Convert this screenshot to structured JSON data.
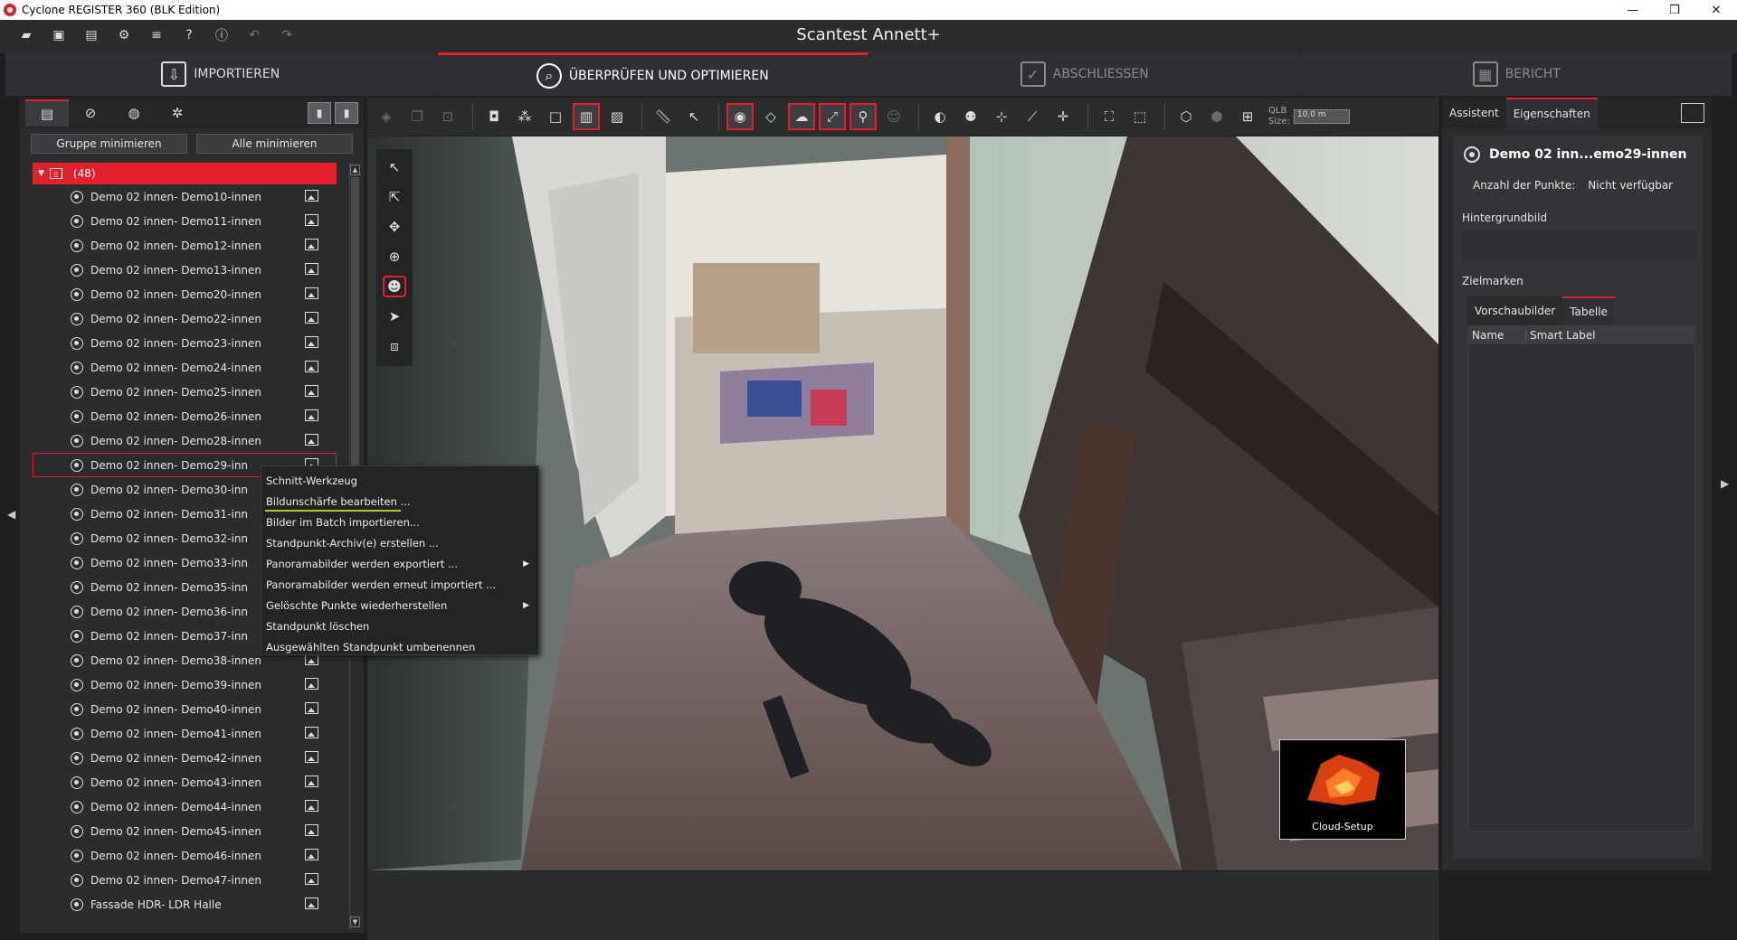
{
  "window": {
    "title": "Cyclone REGISTER 360 (BLK Edition)",
    "controls": [
      "—",
      "❐",
      "✕"
    ]
  },
  "header": {
    "project_title": "Scantest Annett+"
  },
  "steps": [
    {
      "label": "IMPORTIEREN",
      "icon": "import-icon",
      "state": "normal"
    },
    {
      "label": "ÜBERPRÜFEN UND OPTIMIEREN",
      "icon": "review-icon",
      "state": "active"
    },
    {
      "label": "ABSCHLIESSEN",
      "icon": "check-icon",
      "state": "dim"
    },
    {
      "label": "BERICHT",
      "icon": "report-icon",
      "state": "dim"
    }
  ],
  "left_panel": {
    "collapse_group_label": "Gruppe minimieren",
    "collapse_all_label": "Alle minimieren",
    "group_label": "(48)",
    "setups": [
      "Demo 02 innen- Demo10-innen",
      "Demo 02 innen- Demo11-innen",
      "Demo 02 innen- Demo12-innen",
      "Demo 02 innen- Demo13-innen",
      "Demo 02 innen- Demo20-innen",
      "Demo 02 innen- Demo22-innen",
      "Demo 02 innen- Demo23-innen",
      "Demo 02 innen- Demo24-innen",
      "Demo 02 innen- Demo25-innen",
      "Demo 02 innen- Demo26-innen",
      "Demo 02 innen- Demo28-innen",
      "Demo 02 innen- Demo29-inn",
      "Demo 02 innen- Demo30-inn",
      "Demo 02 innen- Demo31-inn",
      "Demo 02 innen- Demo32-inn",
      "Demo 02 innen- Demo33-inn",
      "Demo 02 innen- Demo35-inn",
      "Demo 02 innen- Demo36-inn",
      "Demo 02 innen- Demo37-inn",
      "Demo 02 innen- Demo38-innen",
      "Demo 02 innen- Demo39-innen",
      "Demo 02 innen- Demo40-innen",
      "Demo 02 innen- Demo41-innen",
      "Demo 02 innen- Demo42-innen",
      "Demo 02 innen- Demo43-innen",
      "Demo 02 innen- Demo44-innen",
      "Demo 02 innen- Demo45-innen",
      "Demo 02 innen- Demo46-innen",
      "Demo 02 innen- Demo47-innen",
      "Fassade HDR- LDR Halle"
    ],
    "selected_index": 11
  },
  "context_menu": {
    "items": [
      {
        "label": "Schnitt-Werkzeug",
        "submenu": false
      },
      {
        "label": "Bildunschärfe bearbeiten ...",
        "submenu": false,
        "highlight": true
      },
      {
        "label": "Bilder im Batch importieren...",
        "submenu": false
      },
      {
        "label": "Standpunkt-Archiv(e) erstellen ...",
        "submenu": false
      },
      {
        "label": "Panoramabilder werden exportiert ...",
        "submenu": true
      },
      {
        "label": "Panoramabilder werden erneut importiert ...",
        "submenu": false
      },
      {
        "label": "Gelöschte Punkte wiederherstellen",
        "submenu": true
      },
      {
        "label": "Standpunkt löschen",
        "submenu": false
      },
      {
        "label": "Ausgewählten Standpunkt umbenennen",
        "submenu": false
      }
    ]
  },
  "toolbar": {
    "qlb_label": "QLB",
    "size_label": "Size:",
    "size_value": "10,0 m"
  },
  "viewport": {
    "cloud_setup_label": "Cloud-Setup"
  },
  "right_panel": {
    "tab_assistant": "Assistent",
    "tab_properties": "Eigenschaften",
    "setup_name": "Demo 02 inn...emo29-innen",
    "points_label": "Anzahl der Punkte:",
    "points_value": "Nicht verfügbar",
    "background_label": "Hintergrundbild",
    "targets_label": "Zielmarken",
    "subtab_preview": "Vorschaubilder",
    "subtab_table": "Tabelle",
    "col_name": "Name",
    "col_smart_label": "Smart Label"
  },
  "colors": {
    "accent": "#e2202c",
    "highlight_underline": "#a6d40e",
    "panel_bg": "#2b2c2e"
  }
}
